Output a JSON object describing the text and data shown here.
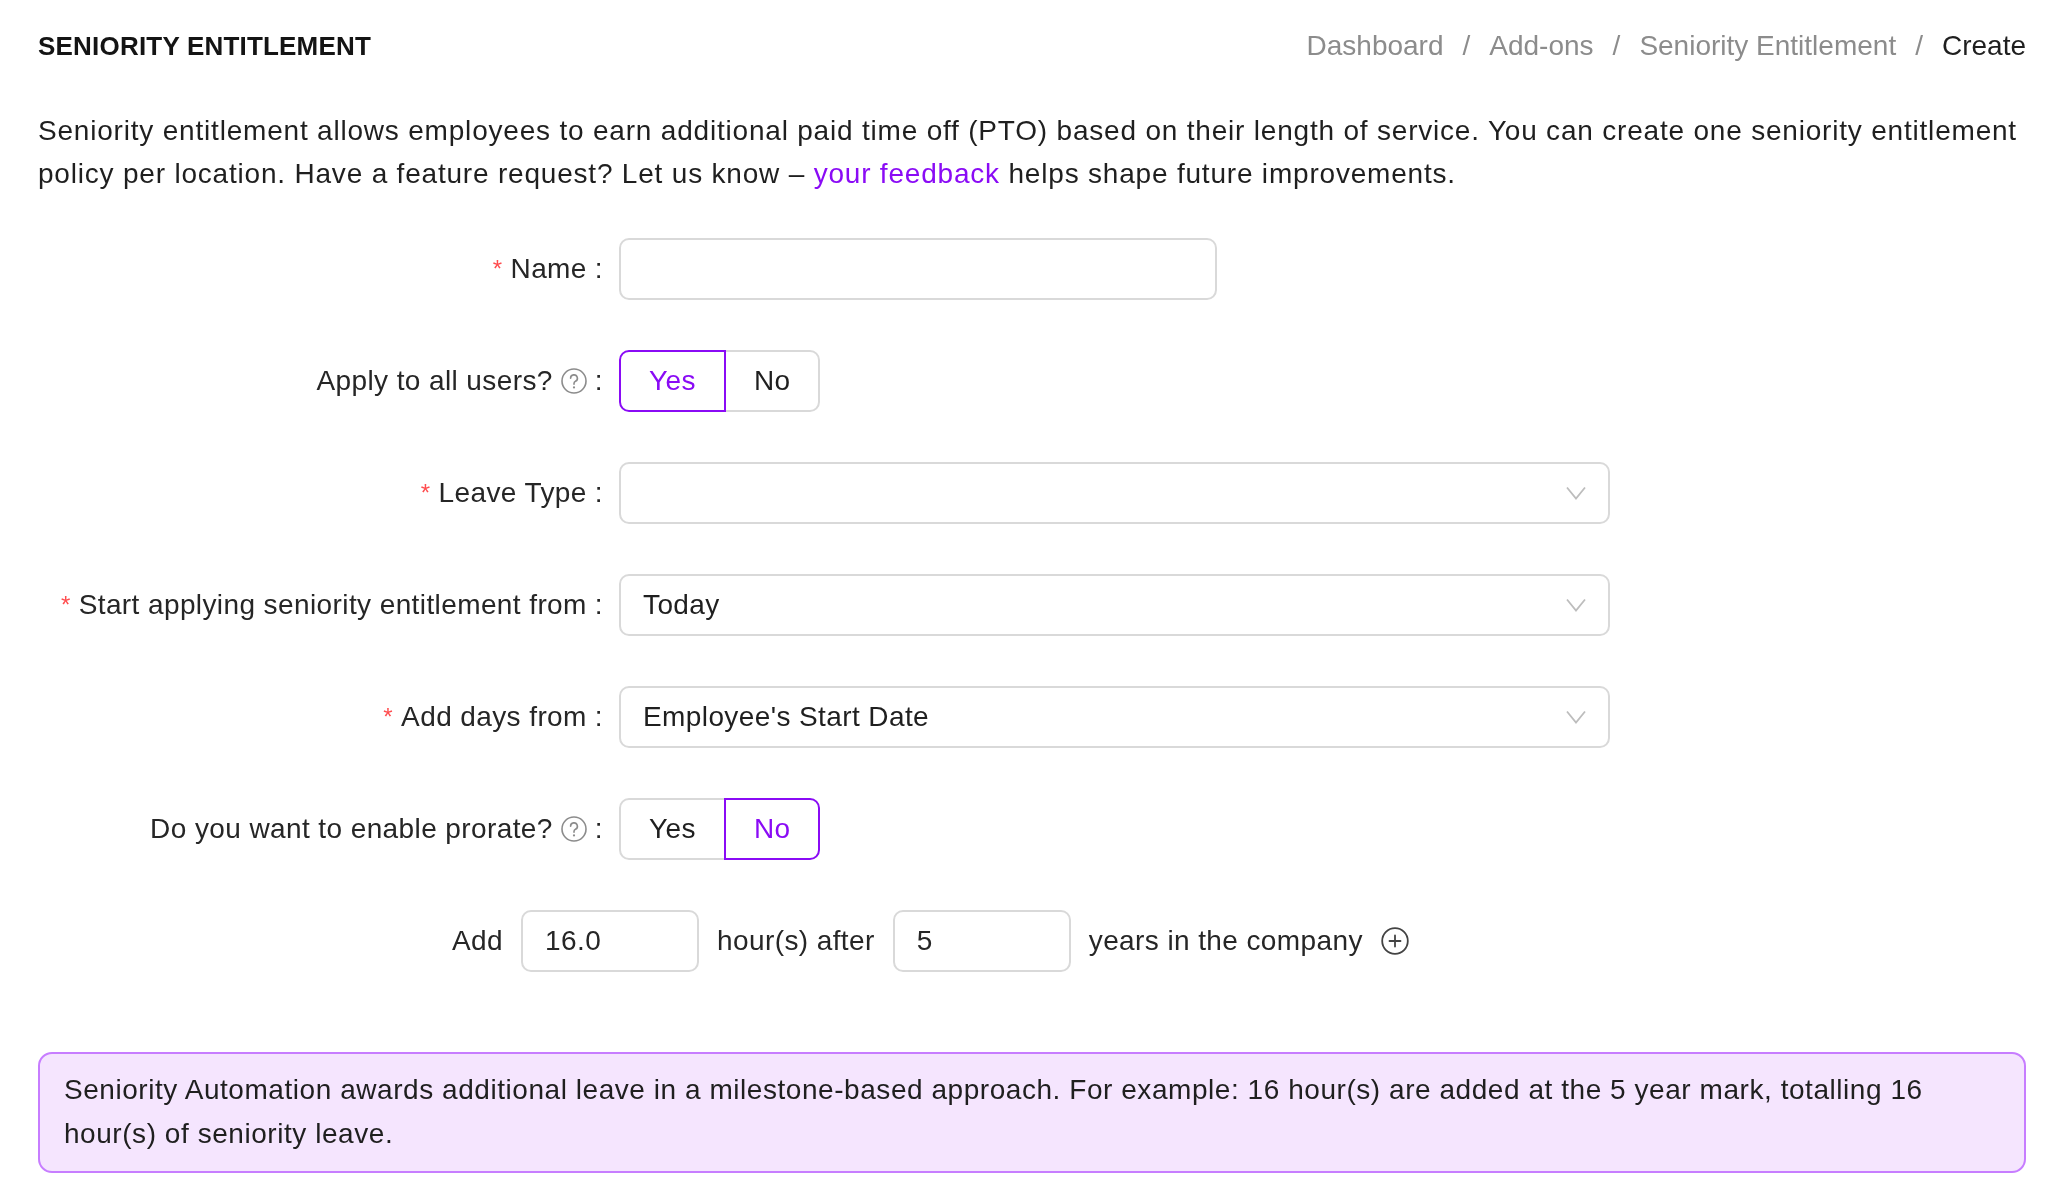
{
  "header": {
    "title": "SENIORITY ENTITLEMENT",
    "breadcrumb": [
      {
        "label": "Dashboard",
        "current": false
      },
      {
        "separator": "/",
        "label": "Add-ons",
        "current": false
      },
      {
        "separator": "/",
        "label": "Seniority Entitlement",
        "current": false
      },
      {
        "separator": "/",
        "label": "Create",
        "current": true
      }
    ]
  },
  "intro": {
    "text_before": "Seniority entitlement allows employees to earn additional paid time off (PTO) based on their length of service. You can create one seniority entitlement policy per location. Have a feature request? Let us know – ",
    "link": "your feedback",
    "text_after": " helps shape future improvements."
  },
  "form": {
    "fields": [
      {
        "kind": "text",
        "required_mark": "*",
        "label": "Name",
        "help": false,
        "colon": ":"
      },
      {
        "kind": "toggle",
        "label": "Apply to all users?",
        "help": true,
        "colon": ":",
        "options": [
          {
            "label": "Yes",
            "selected": true
          },
          {
            "label": "No",
            "selected": false
          }
        ]
      },
      {
        "kind": "select",
        "required_mark": "*",
        "label": "Leave Type",
        "help": false,
        "colon": ":"
      },
      {
        "kind": "select",
        "required_mark": "*",
        "label": "Start applying seniority entitlement from",
        "help": false,
        "colon": ":",
        "value": "Today"
      },
      {
        "kind": "select",
        "required_mark": "*",
        "label": "Add days from",
        "help": false,
        "colon": ":",
        "value": "Employee's Start Date"
      },
      {
        "kind": "toggle",
        "label": "Do you want to enable prorate?",
        "help": true,
        "colon": ":",
        "options": [
          {
            "label": "Yes",
            "selected": false
          },
          {
            "label": "No",
            "selected": true
          }
        ]
      }
    ],
    "rule": {
      "prefix": "Add",
      "hours": "16.0",
      "middle": "hour(s) after",
      "years": "5",
      "suffix": "years in the company"
    }
  },
  "note": "Seniority Automation awards additional leave in a milestone-based approach. For example: 16 hour(s) are added at the 5 year mark, totalling 16 hour(s) of seniority leave."
}
